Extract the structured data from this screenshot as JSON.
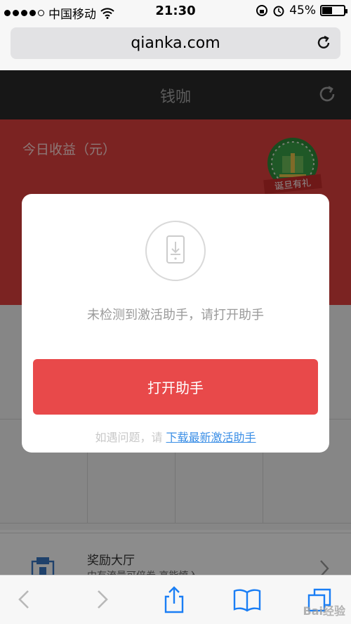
{
  "status_bar": {
    "carrier": "中国移动",
    "time": "21:30",
    "battery": "45%",
    "battery_level": 0.45
  },
  "browser": {
    "url": "qianka.com"
  },
  "app": {
    "title": "钱咖"
  },
  "earnings": {
    "label": "今日收益（元）",
    "badge_text": "诞旦有礼"
  },
  "reward_row": {
    "title": "奖励大厅",
    "subtitle": "中有流量可倍卷,高能慎入"
  },
  "modal": {
    "message": "未检测到激活助手，请打开助手",
    "button_label": "打开助手",
    "footer_prefix": "如遇问题，请",
    "footer_link": "下载最新激活助手"
  },
  "watermark": "Bai经验",
  "colors": {
    "accent_red": "#e8494a",
    "link_blue": "#3a8ee6",
    "header_dark": "#2b2b2b"
  }
}
